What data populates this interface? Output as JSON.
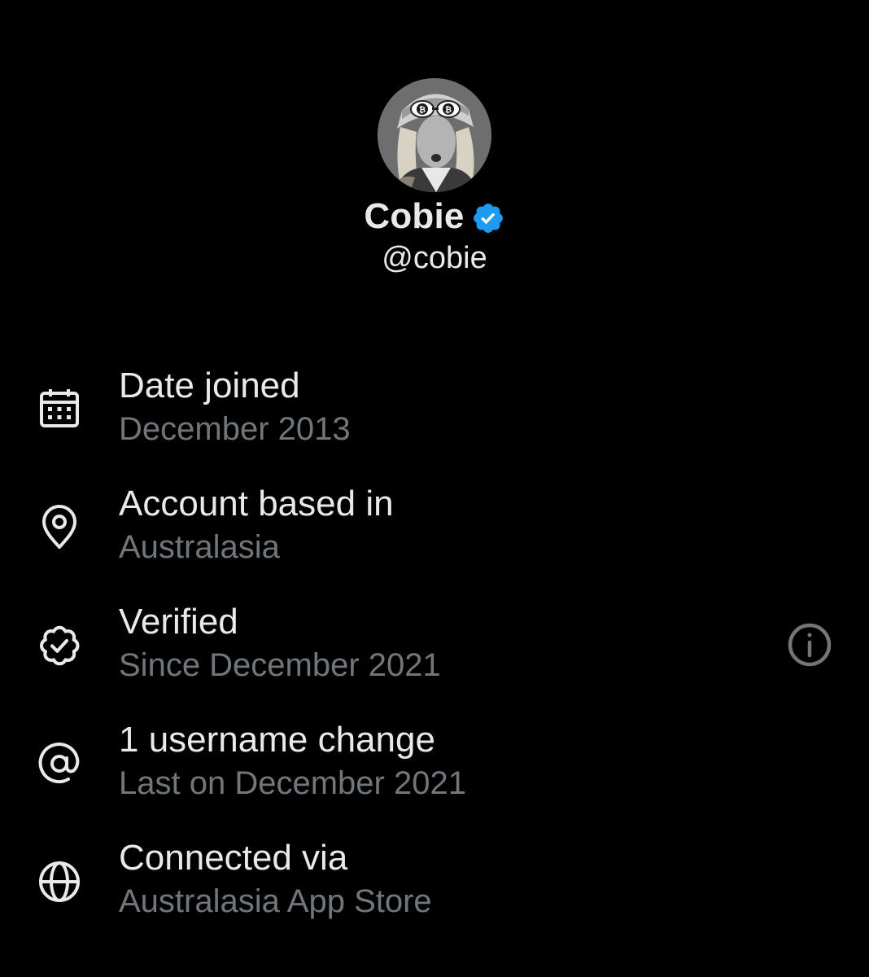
{
  "profile": {
    "display_name": "Cobie",
    "handle": "@cobie",
    "verified": true,
    "verified_badge_color": "#1d9bf0",
    "avatar_lettering": "₿"
  },
  "info_rows": [
    {
      "icon": "calendar-icon",
      "title": "Date joined",
      "subtitle": "December 2013"
    },
    {
      "icon": "location-pin-icon",
      "title": "Account based in",
      "subtitle": "Australasia"
    },
    {
      "icon": "verified-outline-icon",
      "title": "Verified",
      "subtitle": "Since December 2021",
      "action_icon": "info-icon"
    },
    {
      "icon": "at-sign-icon",
      "title": "1 username change",
      "subtitle": "Last on December 2021"
    },
    {
      "icon": "globe-icon",
      "title": "Connected via",
      "subtitle": "Australasia App Store"
    }
  ],
  "colors": {
    "background": "#000000",
    "primary_text": "#e7e9ea",
    "secondary_text": "#71767b",
    "icon": "#e7e9ea",
    "info_icon": "#71767b"
  }
}
